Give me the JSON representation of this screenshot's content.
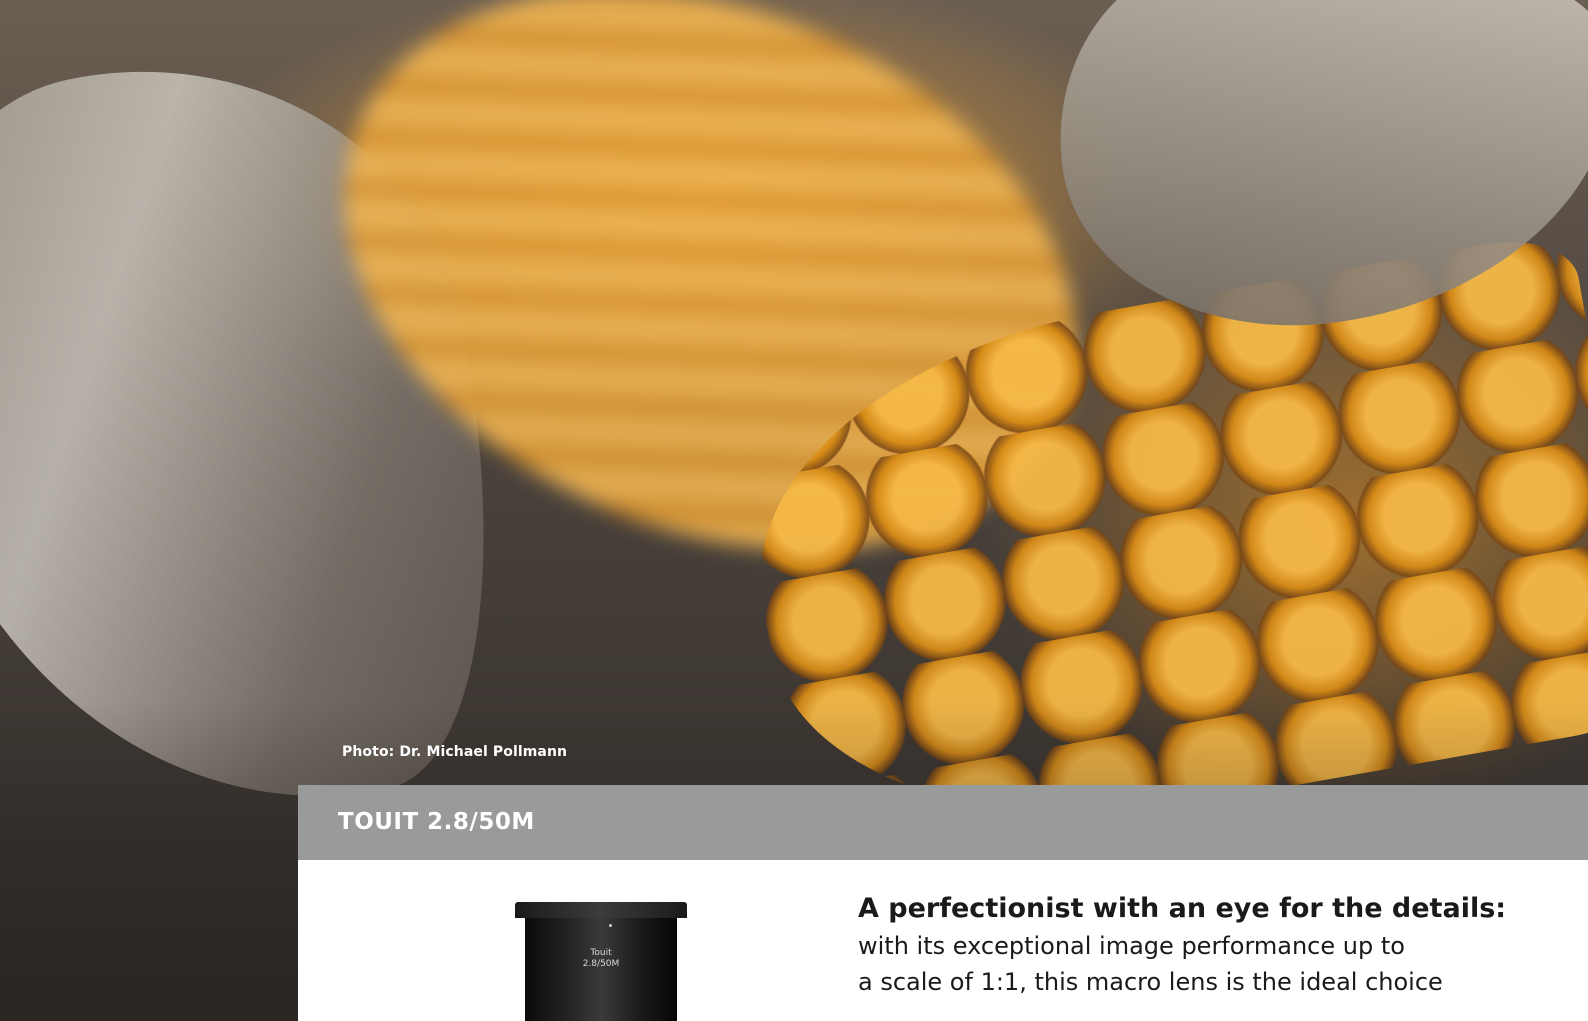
{
  "photo": {
    "credit": "Photo: Dr. Michael Pollmann"
  },
  "product": {
    "title": "TOUIT 2.8/50M",
    "lens_label_line1": "Touit",
    "lens_label_line2": "2.8/50M"
  },
  "description": {
    "lead": "A perfectionist with an eye for the details:",
    "line1": "with its exceptional image performance up to",
    "line2": "a scale of 1:1, this macro lens is the ideal choice"
  }
}
